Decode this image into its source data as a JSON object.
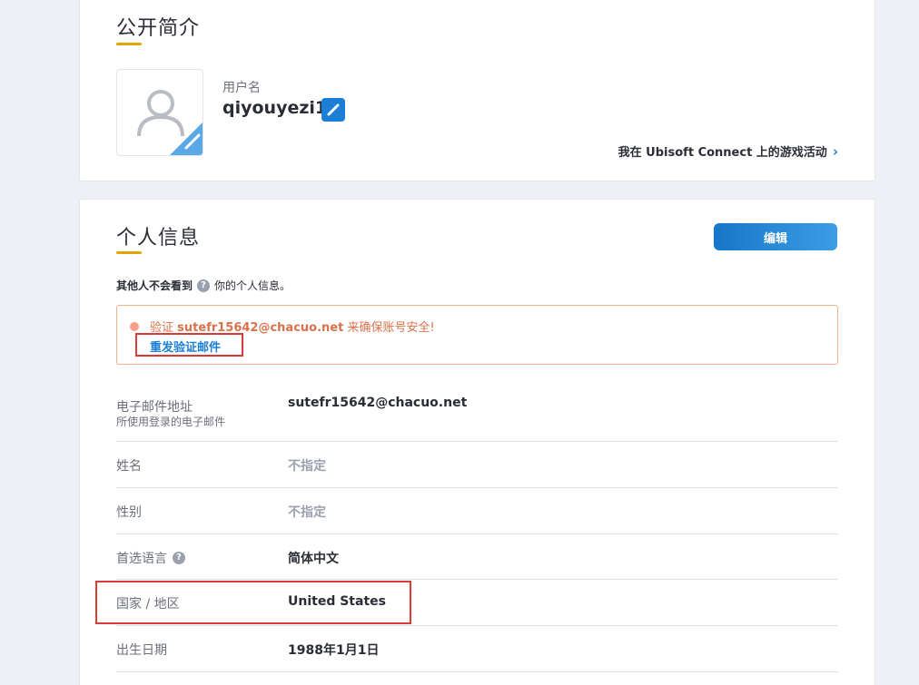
{
  "profile": {
    "title": "公开简介",
    "username_label": "用户名",
    "username": "qiyouyezi1",
    "activity_link": "我在 Ubisoft Connect 上的游戏活动",
    "activity_chevron": "›"
  },
  "info": {
    "title": "个人信息",
    "edit_button": "编辑",
    "privacy_bold": "其他人不会看到",
    "privacy_q": "?",
    "privacy_rest": "你的个人信息。",
    "verify_prefix": "验证",
    "verify_email": "sutefr15642@chacuo.net",
    "verify_suffix": "来确保账号安全!",
    "resend": "重发验证邮件",
    "rows": [
      {
        "label": "电子邮件地址",
        "sublabel": "所使用登录的电子邮件",
        "value": "sutefr15642@chacuo.net"
      },
      {
        "label": "姓名",
        "value": "不指定"
      },
      {
        "label": "性别",
        "value": "不指定"
      },
      {
        "label": "首选语言",
        "value": "简体中文"
      },
      {
        "label": "国家 / 地区",
        "value": "United States"
      },
      {
        "label": "出生日期",
        "value": "1988年1月1日"
      }
    ]
  },
  "colors": {
    "accent": "#1b7fd6",
    "underline": "#e3a400",
    "warning": "#d9724a",
    "highlight": "#d93a3a"
  },
  "icons": {
    "avatar": "user-avatar-icon",
    "edit": "pencil-icon",
    "help": "question-circle-icon",
    "chevron": "chevron-right-icon"
  }
}
